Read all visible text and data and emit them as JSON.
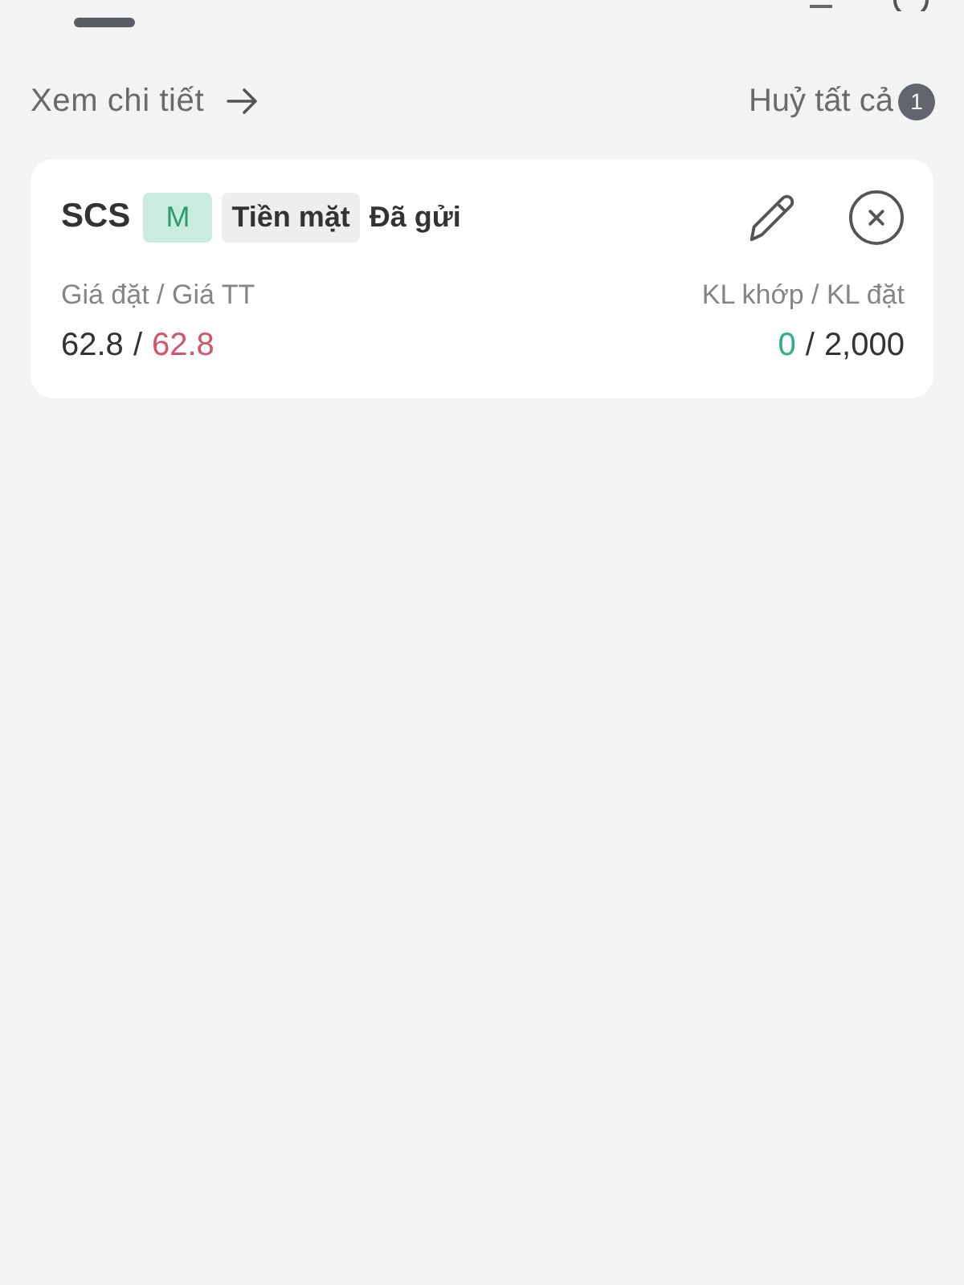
{
  "toolbar": {
    "detail_link": {
      "label": "Xem chi tiết"
    },
    "cancel_all": {
      "label": "Huỷ tất cả",
      "count": "1"
    }
  },
  "orders": [
    {
      "symbol": "SCS",
      "tags": [
        {
          "label": "M",
          "kind": "accent"
        },
        {
          "label": "Tiền mặt",
          "kind": "neutral"
        }
      ],
      "status": "Đã gửi",
      "price_label": "Giá đặt / Giá TT",
      "price": {
        "order": "62.8",
        "separator": "/",
        "market": "62.8"
      },
      "volume_label": "KL khớp / KL đặt",
      "volume": {
        "matched": "0",
        "separator": "/",
        "ordered": "2,000"
      }
    }
  ]
}
